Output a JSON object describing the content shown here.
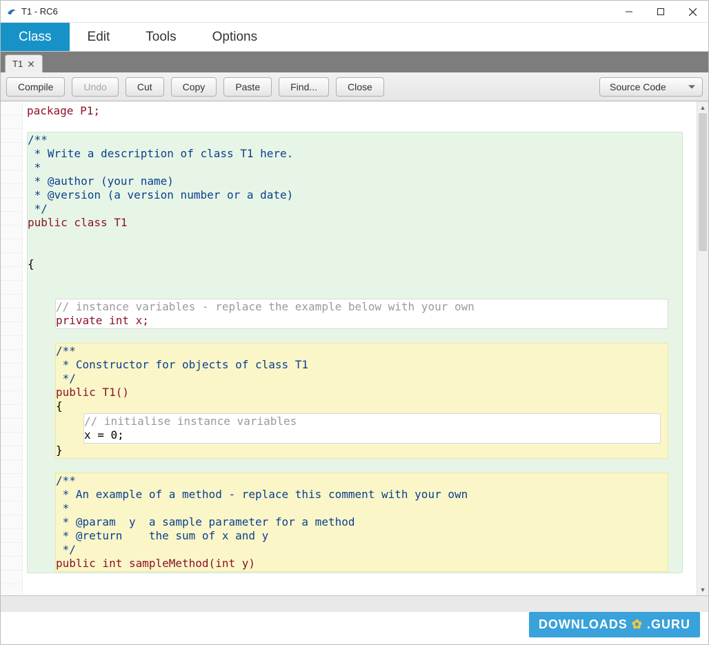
{
  "window": {
    "title": "T1 - RC6"
  },
  "menu": {
    "items": [
      "Class",
      "Edit",
      "Tools",
      "Options"
    ],
    "active_index": 0
  },
  "tabs": {
    "items": [
      {
        "label": "T1"
      }
    ]
  },
  "toolbar": {
    "compile": "Compile",
    "undo": "Undo",
    "cut": "Cut",
    "copy": "Copy",
    "paste": "Paste",
    "find": "Find...",
    "close": "Close",
    "view_selected": "Source Code"
  },
  "code": {
    "l01": "package P1;",
    "l02": "",
    "l03": "/**",
    "l04": " * Write a description of class T1 here.",
    "l05": " *",
    "l06": " * @author (your name)",
    "l07": " * @version (a version number or a date)",
    "l08": " */",
    "l09": "public class T1",
    "l10": "",
    "l11": "",
    "l12": "{",
    "l13": "",
    "l14": "",
    "l15": "// instance variables - replace the example below with your own",
    "l16": "private int x;",
    "l17": "",
    "l18": "/**",
    "l19": " * Constructor for objects of class T1",
    "l20": " */",
    "l21": "public T1()",
    "l22": "{",
    "l23": "// initialise instance variables",
    "l24": "x = 0;",
    "l25": "}",
    "l26": "",
    "l27": "/**",
    "l28": " * An example of a method - replace this comment with your own",
    "l29": " *",
    "l30": " * @param  y  a sample parameter for a method",
    "l31": " * @return    the sum of x and y",
    "l32": " */",
    "l33": "public int sampleMethod(int y)"
  },
  "watermark": {
    "left": "DOWNLOADS",
    "right": ".GURU"
  }
}
